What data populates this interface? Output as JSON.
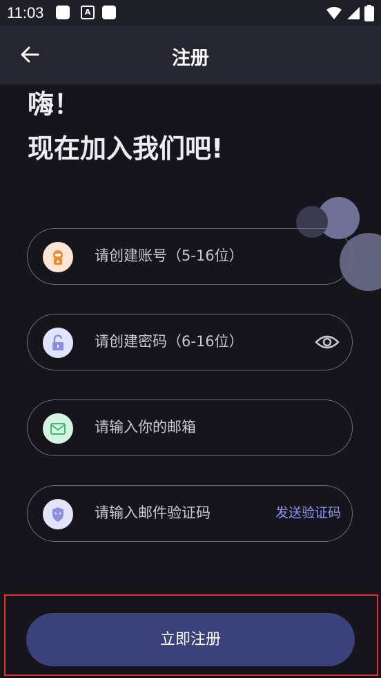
{
  "status_bar": {
    "time": "11:03"
  },
  "header": {
    "title": "注册"
  },
  "greeting": {
    "line1": "嗨！",
    "line2": "现在加入我们吧!"
  },
  "form": {
    "account_placeholder": "请创建账号（5-16位）",
    "password_placeholder": "请创建密码（6-16位）",
    "email_placeholder": "请输入你的邮箱",
    "code_placeholder": "请输入邮件验证码",
    "send_code_label": "发送验证码"
  },
  "submit": {
    "label": "立即注册"
  },
  "colors": {
    "background": "#15151b",
    "accent": "#3b417a",
    "link": "#8e95ee",
    "highlight_border": "#e8322e"
  }
}
